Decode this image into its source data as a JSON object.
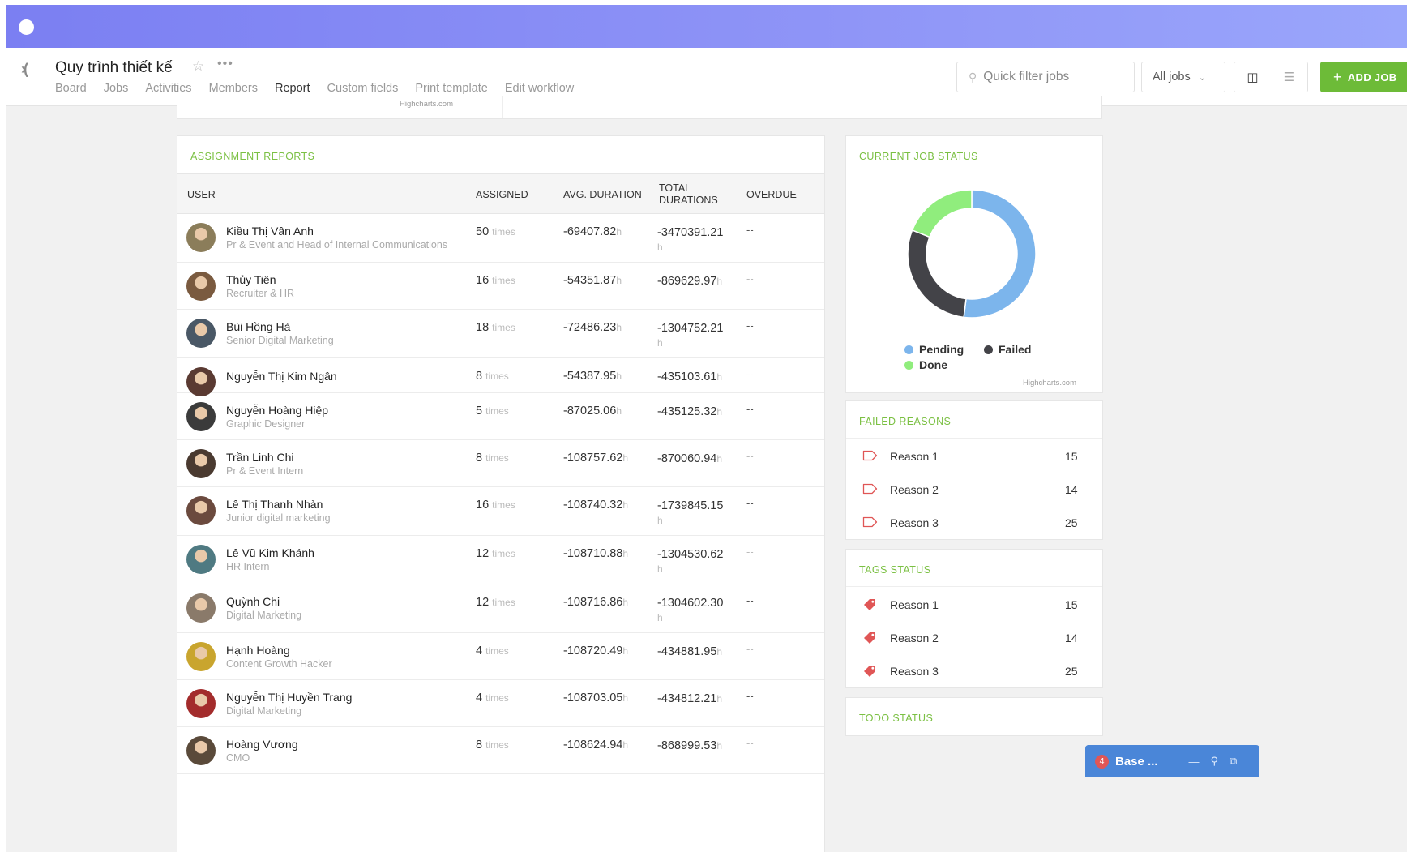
{
  "header": {
    "project_title": "Quy trình thiết kế",
    "tabs": [
      {
        "label": "Board"
      },
      {
        "label": "Jobs"
      },
      {
        "label": "Activities"
      },
      {
        "label": "Members"
      },
      {
        "label": "Report"
      },
      {
        "label": "Custom fields"
      },
      {
        "label": "Print template"
      },
      {
        "label": "Edit workflow"
      }
    ],
    "active_tab": "Report",
    "search_placeholder": "Quick filter jobs",
    "filter_value": "All jobs",
    "add_job_label": "ADD JOB"
  },
  "prev_card": {
    "credit": "Highcharts.com"
  },
  "assignment": {
    "title": "ASSIGNMENT REPORTS",
    "columns": {
      "user": "USER",
      "assigned": "ASSIGNED",
      "avg": "AVG. DURATION",
      "total_line1": "TOTAL",
      "total_line2": "DURATIONS",
      "overdue": "OVERDUE"
    },
    "time_unit": "times",
    "hour_unit": "h",
    "rows": [
      {
        "name": "Kiều Thị Vân Anh",
        "role": "Pr & Event and Head of Internal Communications",
        "assigned": "50",
        "avg": "-69407.82",
        "total": "-3470391.21",
        "overdue": "--",
        "avatar": "#8b7d5a"
      },
      {
        "name": "Thủy Tiên",
        "role": "Recruiter & HR",
        "assigned": "16",
        "avg": "-54351.87",
        "total": "-869629.97",
        "overdue": "--",
        "avatar": "#7a5a3f"
      },
      {
        "name": "Bùi Hồng Hà",
        "role": "Senior Digital Marketing",
        "assigned": "18",
        "avg": "-72486.23",
        "total": "-1304752.21",
        "overdue": "--",
        "avatar": "#4a5866"
      },
      {
        "name": "Nguyễn Thị Kim Ngân",
        "role": "",
        "assigned": "8",
        "avg": "-54387.95",
        "total": "-435103.61",
        "overdue": "--",
        "avatar": "#5a3a32"
      },
      {
        "name": "Nguyễn Hoàng Hiệp",
        "role": "Graphic Designer",
        "assigned": "5",
        "avg": "-87025.06",
        "total": "-435125.32",
        "overdue": "--",
        "avatar": "#3b3b3b"
      },
      {
        "name": "Trần Linh Chi",
        "role": "Pr & Event Intern",
        "assigned": "8",
        "avg": "-108757.62",
        "total": "-870060.94",
        "overdue": "--",
        "avatar": "#4a3a30"
      },
      {
        "name": "Lê Thị Thanh Nhàn",
        "role": "Junior digital marketing",
        "assigned": "16",
        "avg": "-108740.32",
        "total": "-1739845.15",
        "overdue": "--",
        "avatar": "#6b4a3e"
      },
      {
        "name": "Lê Vũ Kim Khánh",
        "role": "HR Intern",
        "assigned": "12",
        "avg": "-108710.88",
        "total": "-1304530.62",
        "overdue": "--",
        "avatar": "#4f7a82"
      },
      {
        "name": "Quỳnh Chi",
        "role": "Digital Marketing",
        "assigned": "12",
        "avg": "-108716.86",
        "total": "-1304602.30",
        "overdue": "--",
        "avatar": "#8a7a6a"
      },
      {
        "name": "Hạnh Hoàng",
        "role": "Content Growth Hacker",
        "assigned": "4",
        "avg": "-108720.49",
        "total": "-434881.95",
        "overdue": "--",
        "avatar": "#c9a52e"
      },
      {
        "name": "Nguyễn Thị Huyền Trang",
        "role": "Digital Marketing",
        "assigned": "4",
        "avg": "-108703.05",
        "total": "-434812.21",
        "overdue": "--",
        "avatar": "#a32c2c"
      },
      {
        "name": "Hoàng Vương",
        "role": "CMO",
        "assigned": "8",
        "avg": "-108624.94",
        "total": "-868999.53",
        "overdue": "--",
        "avatar": "#5a4a3a"
      }
    ]
  },
  "job_status": {
    "title": "CURRENT JOB STATUS",
    "credit": "Highcharts.com",
    "chart_data": {
      "type": "pie",
      "categories": [
        "Pending",
        "Failed",
        "Done"
      ],
      "values": [
        52,
        29,
        19
      ],
      "colors": [
        "#7cb5ec",
        "#434348",
        "#90ed7d"
      ],
      "legend": "bottom"
    }
  },
  "failed_reasons": {
    "title": "FAILED REASONS",
    "items": [
      {
        "name": "Reason 1",
        "value": "15"
      },
      {
        "name": "Reason 2",
        "value": "14"
      },
      {
        "name": "Reason 3",
        "value": "25"
      }
    ]
  },
  "tags_status": {
    "title": "TAGS STATUS",
    "items": [
      {
        "name": "Reason 1",
        "value": "15"
      },
      {
        "name": "Reason 2",
        "value": "14"
      },
      {
        "name": "Reason 3",
        "value": "25"
      }
    ]
  },
  "todo_status": {
    "title": "TODO STATUS"
  },
  "base_widget": {
    "badge": "4",
    "label": "Base ..."
  },
  "colors": {
    "accent_green": "#6dbb38",
    "title_green": "#7bc043",
    "tab_underline": "#55b9e8",
    "tag_red": "#e05656"
  }
}
